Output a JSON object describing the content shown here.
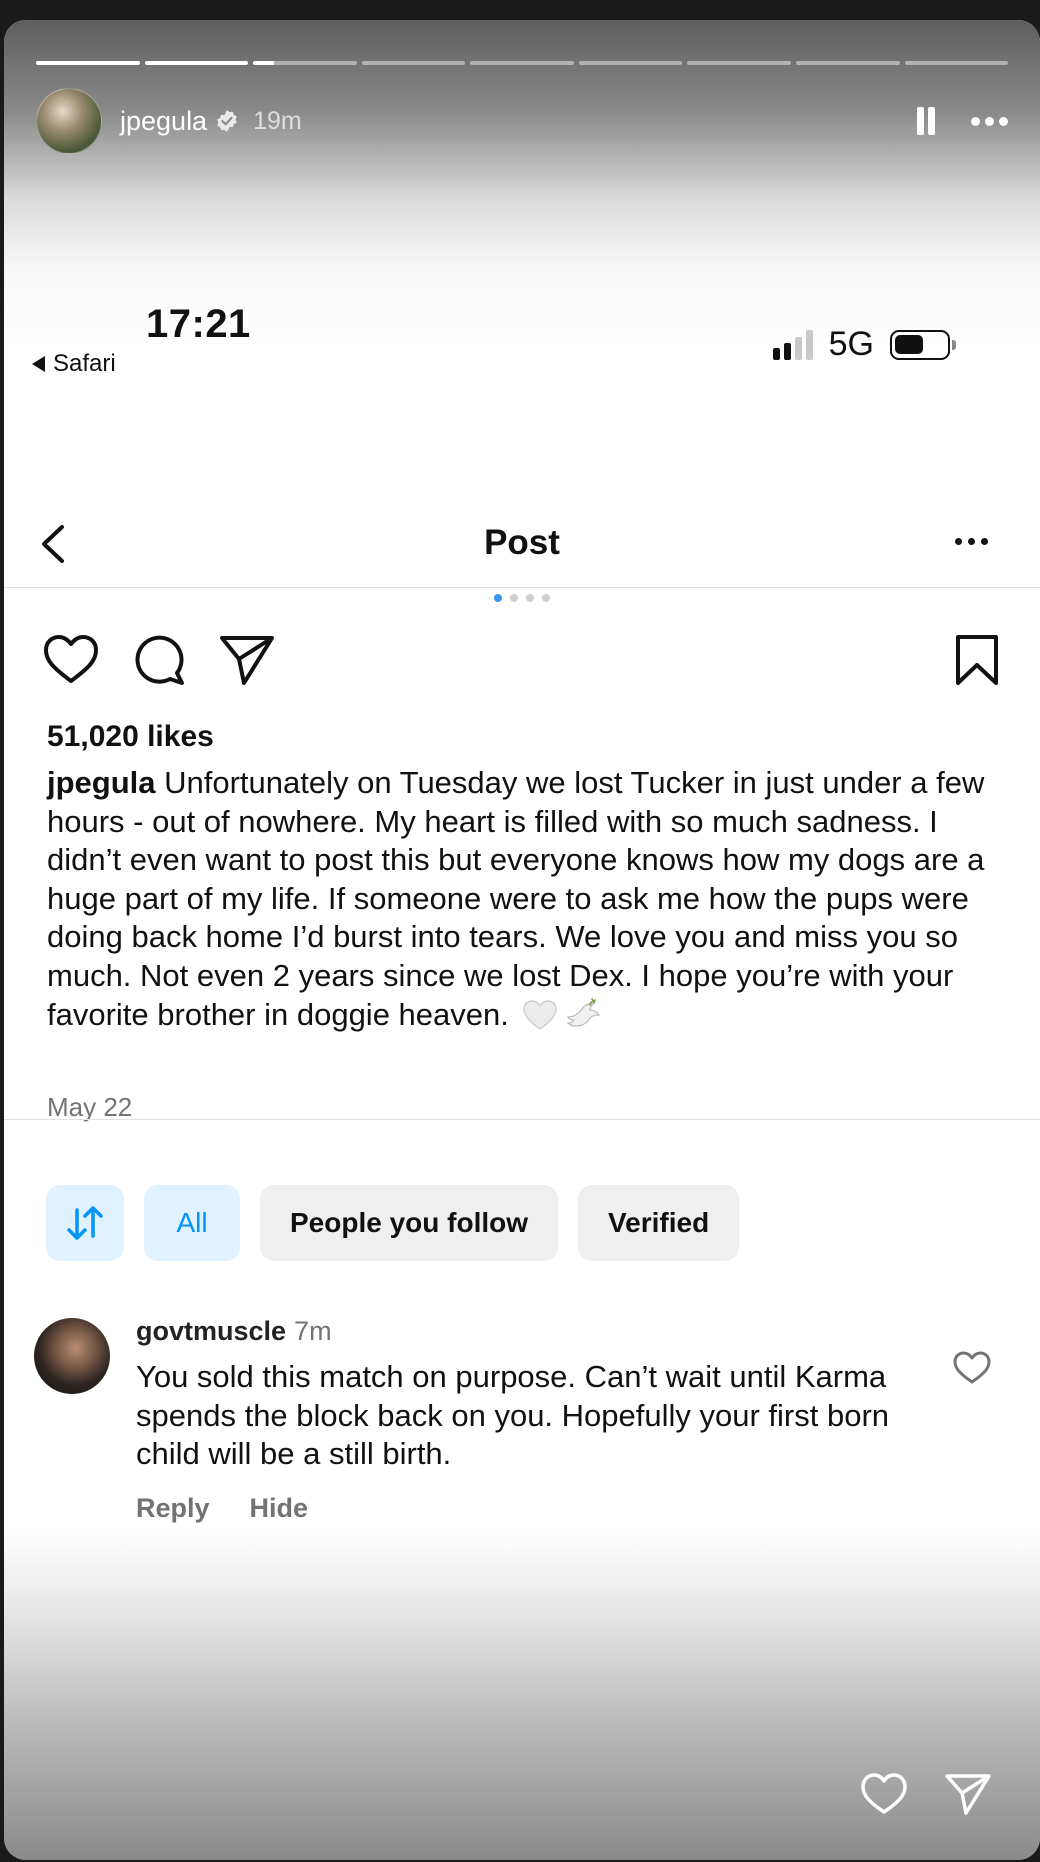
{
  "story": {
    "username": "jpegula",
    "time": "19m",
    "progress": [
      1,
      1,
      0.2,
      0,
      0,
      0,
      0,
      0,
      0
    ]
  },
  "status_bar": {
    "time": "17:21",
    "back_app": "Safari",
    "network": "5G"
  },
  "nav": {
    "title": "Post"
  },
  "post": {
    "likes": "51,020 likes",
    "author": "jpegula",
    "caption": " Unfortunately on Tuesday we lost Tucker in just under a few hours - out of nowhere. My heart is filled with so much sadness. I didn’t even want to post this but everyone knows how my dogs are a huge part of my life. If someone were to ask me how the pups were doing back home I’d burst into tears. We love you and miss you so much. Not even 2 years since we lost Dex. I hope you’re with your favorite brother in doggie heaven.",
    "date": "May 22"
  },
  "filters": {
    "all": "All",
    "people": "People you follow",
    "verified": "Verified"
  },
  "comment": {
    "user": "govtmuscle",
    "time": "7m",
    "text": "You sold this match on purpose. Can’t wait until Karma spends the block back on you. Hopefully your first born child will be a still birth.",
    "reply": "Reply",
    "hide": "Hide"
  },
  "colors": {
    "accent": "#0095f6",
    "chip_bg": "#efefef",
    "muted": "#737373"
  },
  "icons": [
    "verified-icon",
    "pause-icon",
    "more-icon",
    "back-icon",
    "heart-icon",
    "comment-icon",
    "share-icon",
    "bookmark-icon",
    "sort-icon",
    "like-comment-icon"
  ]
}
